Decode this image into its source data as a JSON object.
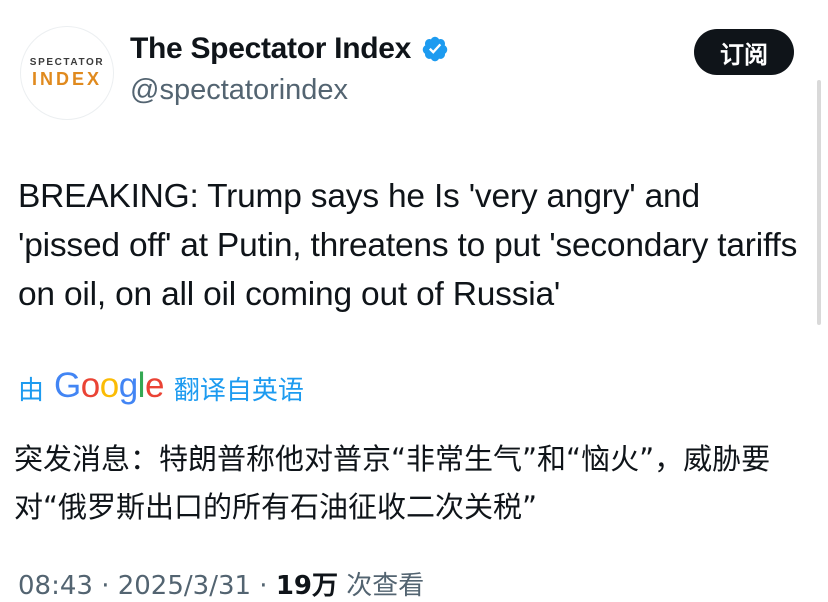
{
  "account": {
    "avatar_line1": "SPECTATOR",
    "avatar_line2": "INDEX",
    "display_name": "The Spectator Index",
    "handle": "@spectatorindex",
    "subscribe_label": "订阅"
  },
  "tweet": {
    "text": "BREAKING: Trump says he Is 'very angry' and 'pissed off' at Putin, threatens to put 'secondary tariffs on oil, on all oil coming out of Russia'"
  },
  "translation": {
    "prefix": "由",
    "provider": "Google",
    "label": "翻译自英语",
    "text": "突发消息：特朗普称他对普京“非常生气”和“恼火”，威胁要对“俄罗斯出口的所有石油征收二次关税”"
  },
  "meta": {
    "time_date": "08:43 · 2025/3/31 · ",
    "views_count": "19万",
    "views_label": " 次查看"
  },
  "colors": {
    "accent": "#1d9bf0",
    "text": "#0f1419",
    "muted": "#536471",
    "avatar_brand": "#e08a1e"
  },
  "icons": {
    "verified": "verified-badge-icon"
  }
}
